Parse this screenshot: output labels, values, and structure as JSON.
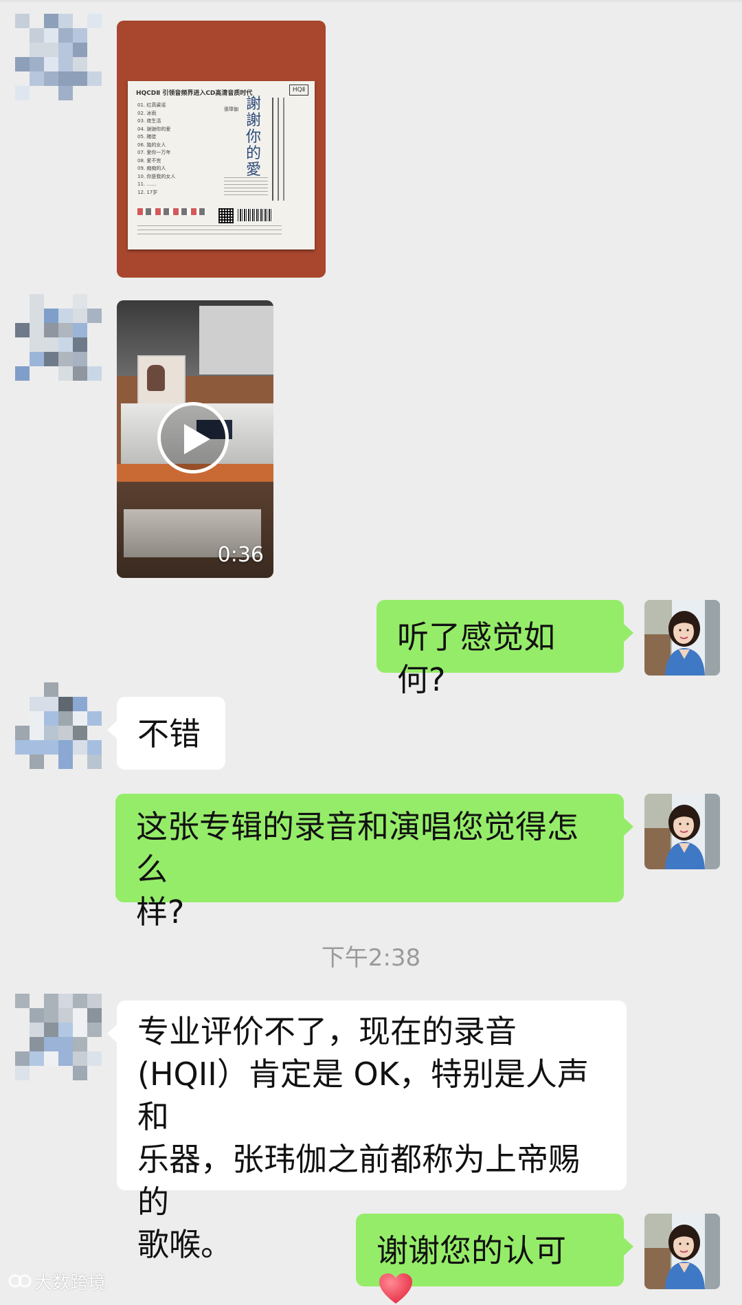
{
  "chat": {
    "timestamp": "下午2:38",
    "video": {
      "duration": "0:36"
    },
    "cd_cover": {
      "header": "HQCDⅡ 引领音频界进入CD高清音质时代",
      "album_title": "謝謝你的愛",
      "artist": "張瑋伽",
      "badge": "HQⅡ",
      "tracks": [
        "01. 红高粱谣",
        "02. 冰雨",
        "03. 夜生活",
        "04. 谢谢你的爱",
        "05. 赌徒",
        "06. 独的女人",
        "07. 爱你一万年",
        "08. 爱不完",
        "09. 痴痴的人",
        "10. 你是我的女人",
        "11. ……",
        "12. 17岁"
      ]
    },
    "messages": [
      {
        "side": "left",
        "kind": "image",
        "name": "cd-cover-photo"
      },
      {
        "side": "left",
        "kind": "video",
        "name": "video-message"
      },
      {
        "side": "right",
        "kind": "text",
        "text": "听了感觉如何?"
      },
      {
        "side": "left",
        "kind": "text",
        "text": "不错"
      },
      {
        "side": "right",
        "kind": "text",
        "lines": [
          "这张专辑的录音和演唱您觉得怎么",
          "样?"
        ]
      },
      {
        "side": "left",
        "kind": "text",
        "lines": [
          "专业评价不了，现在的录音",
          "(HQII）肯定是 OK，特别是人声和",
          "乐器，张玮伽之前都称为上帝赐的",
          "歌喉。"
        ]
      },
      {
        "side": "right",
        "kind": "text",
        "text": "谢谢您的认可",
        "emoji": "heart"
      }
    ]
  },
  "watermark": "大数跨境",
  "colors": {
    "background": "#ededed",
    "bubble_green": "#95ec69",
    "bubble_white": "#ffffff",
    "heart": "#e8344a"
  }
}
